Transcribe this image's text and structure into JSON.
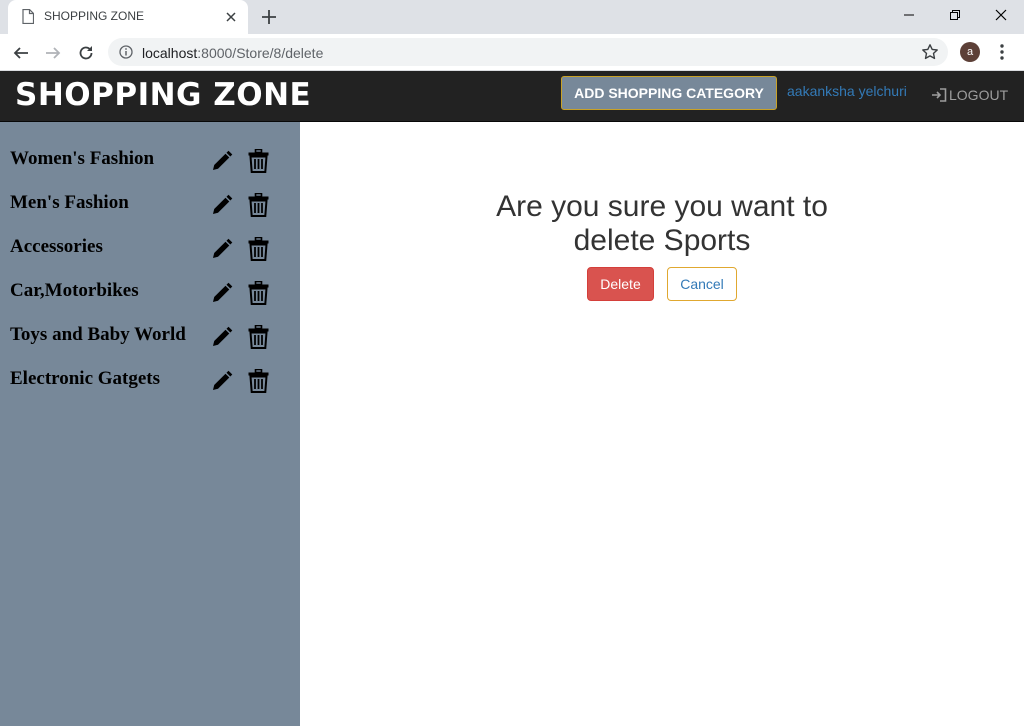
{
  "browser": {
    "tab_title": "SHOPPING ZONE",
    "url_host": "localhost",
    "url_rest": ":8000/Store/8/delete",
    "profile_initial": "a"
  },
  "navbar": {
    "brand": "SHOPPING ZONE",
    "add_category_label": "ADD SHOPPING CATEGORY",
    "user_name": "aakanksha yelchuri",
    "logout_label": "LOGOUT"
  },
  "sidebar": {
    "categories": [
      {
        "label": "Women's Fashion"
      },
      {
        "label": "Men's Fashion"
      },
      {
        "label": "Accessories"
      },
      {
        "label": "Car,Motorbikes"
      },
      {
        "label": "Toys and Baby World"
      },
      {
        "label": "Electronic Gatgets"
      }
    ]
  },
  "main": {
    "confirm_line1": "Are you sure you want to",
    "confirm_line2": "delete Sports",
    "delete_label": "Delete",
    "cancel_label": "Cancel"
  },
  "colors": {
    "navbar_bg": "#222222",
    "sidebar_bg": "#778899",
    "delete_btn": "#d9534f",
    "link": "#337ab7"
  }
}
